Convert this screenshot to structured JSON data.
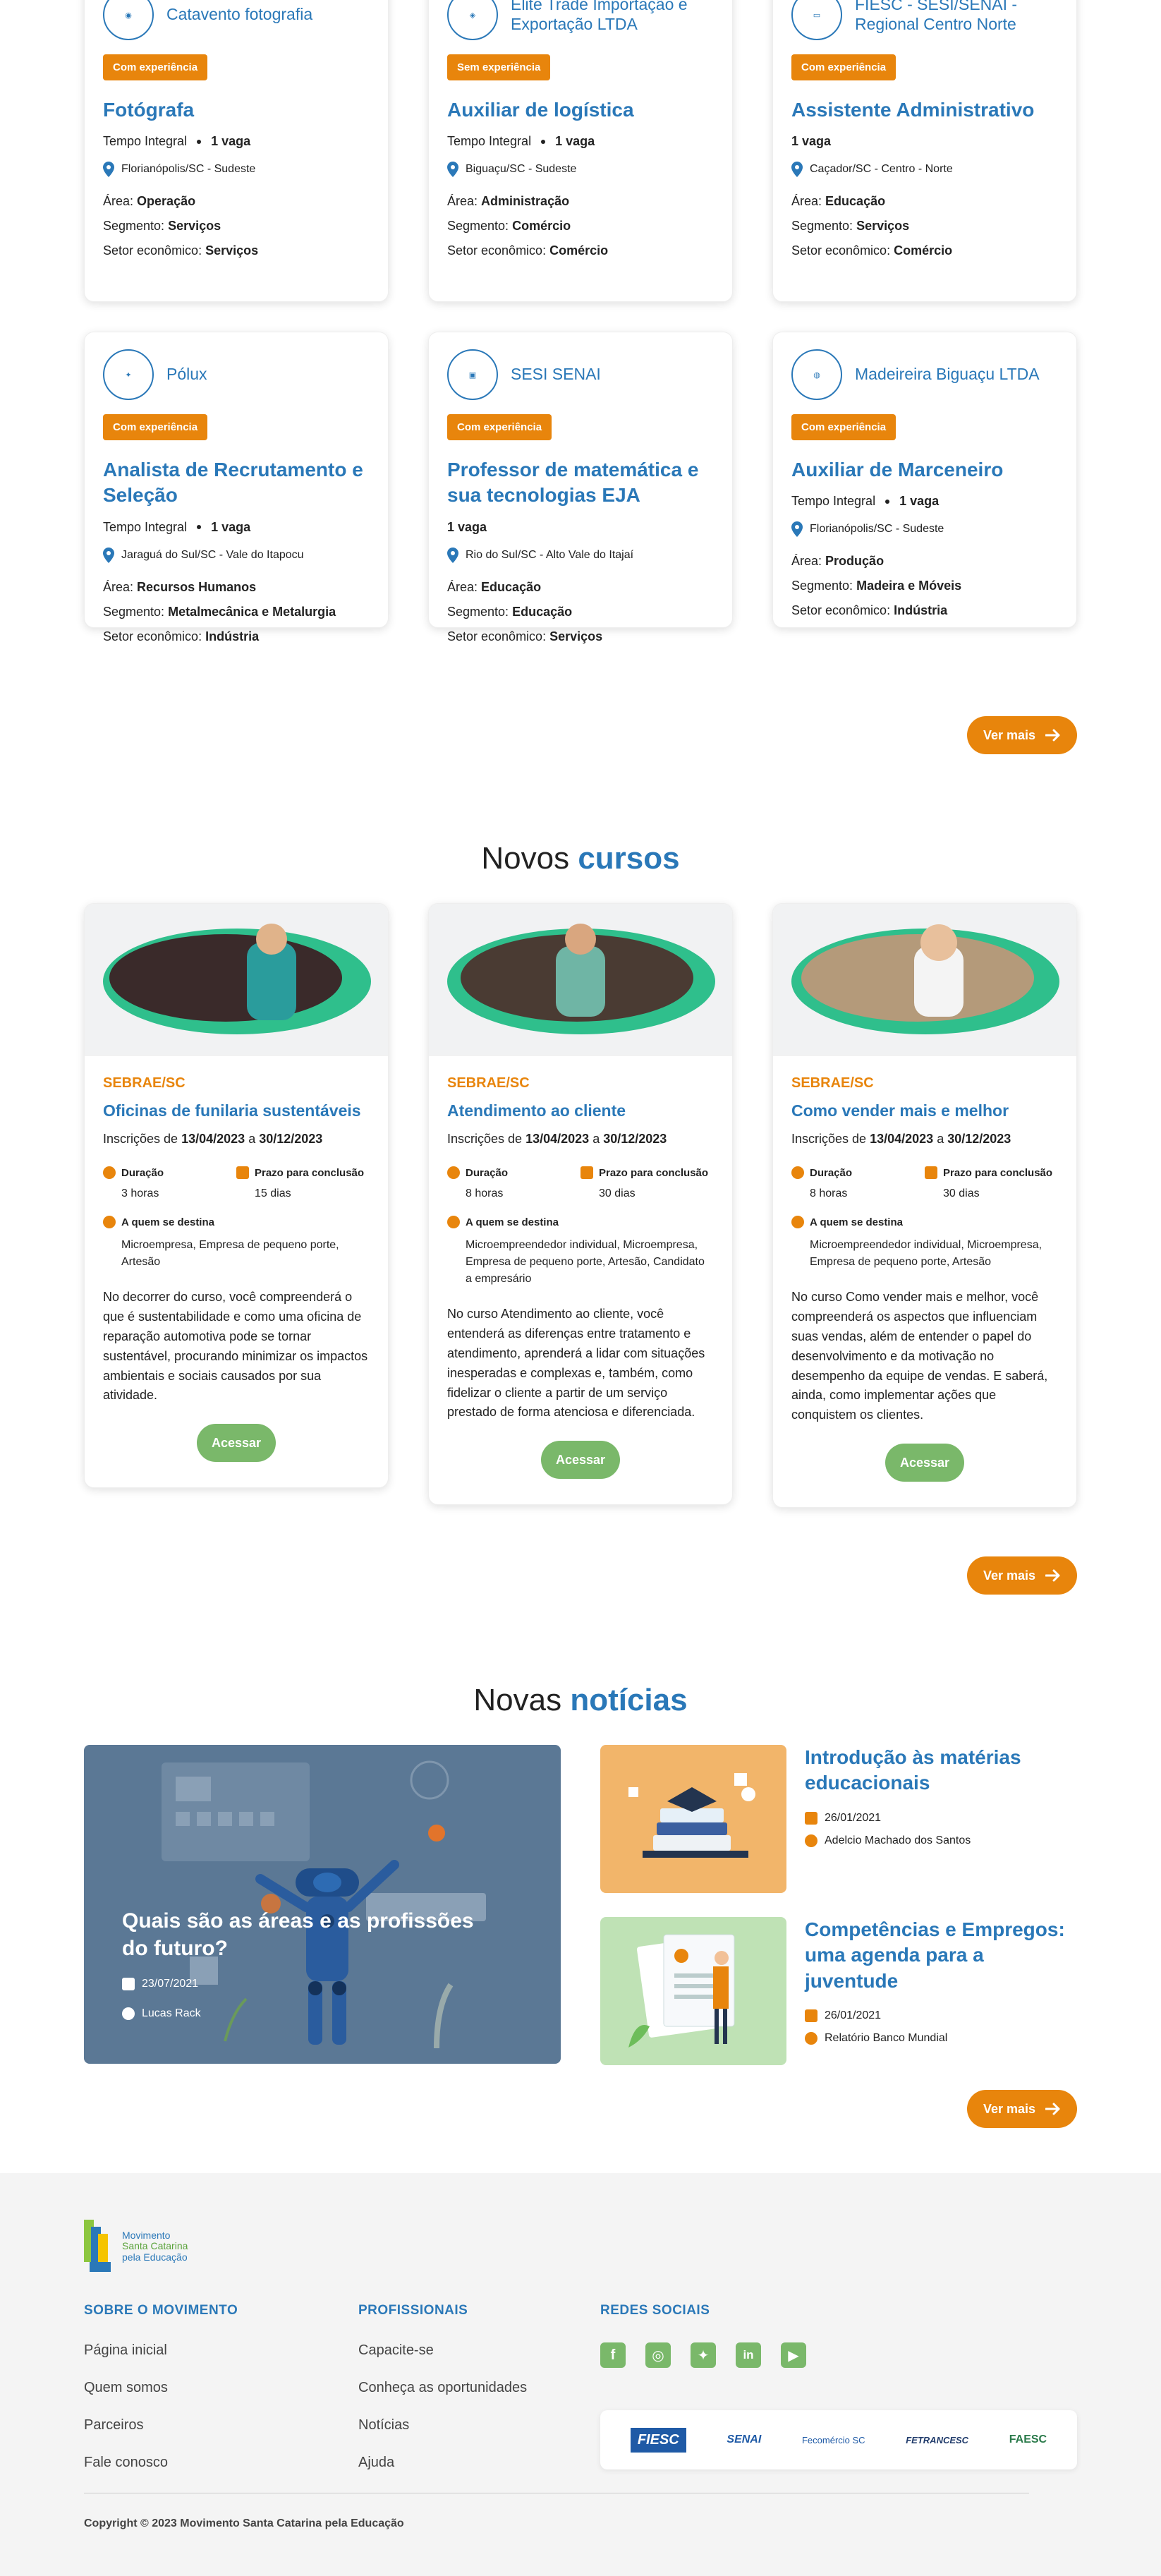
{
  "jobs_row1": [
    {
      "company": "Catavento fotografia",
      "badge": "Com experiência",
      "title": "Fotógrafa",
      "schedule": "Tempo Integral",
      "vacancies": "1 vaga",
      "location": "Florianópolis/SC - Sudeste",
      "area": "Operação",
      "segment": "Serviços",
      "sector": "Serviços"
    },
    {
      "company": "Elite Trade Importação e Exportação LTDA",
      "badge": "Sem experiência",
      "title": "Auxiliar de logística",
      "schedule": "Tempo Integral",
      "vacancies": "1 vaga",
      "location": "Biguaçu/SC - Sudeste",
      "area": "Administração",
      "segment": "Comércio",
      "sector": "Comércio"
    },
    {
      "company": "FIESC - SESI/SENAI - Regional Centro Norte",
      "badge": "Com experiência",
      "title": "Assistente Administrativo",
      "schedule": "",
      "vacancies": "1 vaga",
      "location": "Caçador/SC - Centro - Norte",
      "area": "Educação",
      "segment": "Serviços",
      "sector": "Comércio"
    }
  ],
  "jobs_row2": [
    {
      "company": "Pólux",
      "badge": "Com experiência",
      "title": "Analista de Recrutamento e Seleção",
      "schedule": "Tempo Integral",
      "vacancies": "1 vaga",
      "location": "Jaraguá do Sul/SC - Vale do Itapocu",
      "area": "Recursos Humanos",
      "segment": "Metalmecânica e Metalurgia",
      "sector": "Indústria"
    },
    {
      "company": "SESI SENAI",
      "badge": "Com experiência",
      "title": "Professor de matemática e sua tecnologias EJA",
      "schedule": "",
      "vacancies": "1 vaga",
      "location": "Rio do Sul/SC - Alto Vale do Itajaí",
      "area": "Educação",
      "segment": "Educação",
      "sector": "Serviços"
    },
    {
      "company": "Madeireira Biguaçu LTDA",
      "badge": "Com experiência",
      "title": "Auxiliar de Marceneiro",
      "schedule": "Tempo Integral",
      "vacancies": "1 vaga",
      "location": "Florianópolis/SC - Sudeste",
      "area": "Produção",
      "segment": "Madeira e Móveis",
      "sector": "Indústria"
    }
  ],
  "labels": {
    "area": "Área:",
    "segment": "Segmento:",
    "sector": "Setor econômico:",
    "ver_mais": "Ver mais",
    "acessar": "Acessar",
    "duracao": "Duração",
    "prazo": "Prazo para conclusão",
    "destina": "A quem se destina",
    "inscricoes": "Inscrições de",
    "a": "a"
  },
  "courses_title": {
    "prefix": "Novos ",
    "highlight": "cursos"
  },
  "courses": [
    {
      "provider": "SEBRAE/SC",
      "title": "Oficinas de funilaria sustentáveis",
      "start": "13/04/2023",
      "end": "30/12/2023",
      "duration": "3 horas",
      "deadline": "15 dias",
      "audience": "Microempresa, Empresa de pequeno porte, Artesão",
      "description": "No decorrer do curso, você compreenderá o que é sustentabilidade e como uma oficina de reparação automotiva pode se tornar sustentável, procurando minimizar os impactos ambientais e sociais causados por sua atividade."
    },
    {
      "provider": "SEBRAE/SC",
      "title": "Atendimento ao cliente",
      "start": "13/04/2023",
      "end": "30/12/2023",
      "duration": "8 horas",
      "deadline": "30 dias",
      "audience": "Microempreendedor individual, Microempresa, Empresa de pequeno porte, Artesão, Candidato a empresário",
      "description": "No curso Atendimento ao cliente, você entenderá as diferenças entre tratamento e atendimento, aprenderá a lidar com situações inesperadas e complexas e, também, como fidelizar o cliente a partir de um serviço prestado de forma atenciosa e diferenciada."
    },
    {
      "provider": "SEBRAE/SC",
      "title": "Como vender mais e melhor",
      "start": "13/04/2023",
      "end": "30/12/2023",
      "duration": "8 horas",
      "deadline": "30 dias",
      "audience": "Microempreendedor individual, Microempresa, Empresa de pequeno porte, Artesão",
      "description": "No curso Como vender mais e melhor, você compreenderá os aspectos que influenciam suas vendas, além de entender o papel do desenvolvimento e da motivação no desempenho da equipe de vendas. E saberá, ainda, como implementar ações que conquistem os clientes."
    }
  ],
  "news_title": {
    "prefix": "Novas ",
    "highlight": "notícias"
  },
  "news_featured": {
    "title": "Quais são as áreas e as profissões do futuro?",
    "date": "23/07/2021",
    "author": "Lucas Rack"
  },
  "news": [
    {
      "title": "Introdução às matérias educacionais",
      "date": "26/01/2021",
      "author": "Adelcio Machado dos Santos"
    },
    {
      "title": "Competências e Empregos: uma agenda para a juventude",
      "date": "26/01/2021",
      "author": "Relatório Banco Mundial"
    }
  ],
  "footer": {
    "logo_text": [
      "Movimento",
      "Santa Catarina",
      "pela Educação"
    ],
    "col1_head": "SOBRE O MOVIMENTO",
    "col1_links": [
      "Página inicial",
      "Quem somos",
      "Parceiros",
      "Fale conosco"
    ],
    "col2_head": "PROFISSIONAIS",
    "col2_links": [
      "Capacite-se",
      "Conheça as oportunidades",
      "Notícias",
      "Ajuda"
    ],
    "col3_head": "REDES SOCIAIS",
    "social": [
      "facebook-icon",
      "instagram-icon",
      "twitter-icon",
      "linkedin-icon",
      "youtube-icon"
    ],
    "partners": [
      "FIESC",
      "SENAI",
      "Fecomércio SC",
      "FETRANCESC",
      "FAESC"
    ],
    "copyright": "Copyright © 2023 Movimento Santa Catarina pela Educação"
  },
  "colors": {
    "accent": "#2a78b8",
    "orange": "#e8850c",
    "green": "#7ab86a"
  }
}
